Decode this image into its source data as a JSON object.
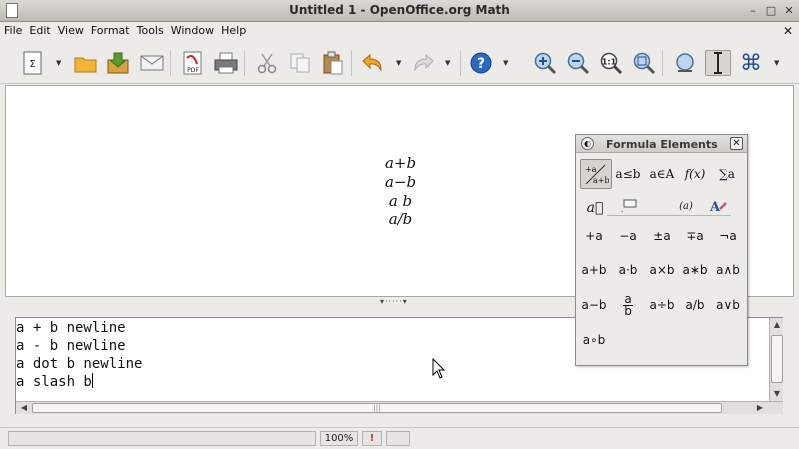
{
  "window": {
    "title": "Untitled 1 - OpenOffice.org Math",
    "buttons": {
      "minimize": "–",
      "maximize": "□",
      "close": "✕"
    }
  },
  "menubar": {
    "items": [
      "File",
      "Edit",
      "View",
      "Format",
      "Tools",
      "Window",
      "Help"
    ],
    "close_doc": "✕"
  },
  "toolbar": {
    "icons": [
      "new-formula-icon",
      "open-icon",
      "save-icon",
      "email-icon",
      "export-pdf-icon",
      "print-icon",
      "cut-icon",
      "copy-icon",
      "paste-icon",
      "undo-icon",
      "redo-icon",
      "help-icon",
      "zoom-in-icon",
      "zoom-out-icon",
      "zoom-100-icon",
      "show-all-icon",
      "update-icon",
      "formula-cursor-icon",
      "symbols-icon"
    ]
  },
  "preview": {
    "lines": [
      "a+b",
      "a−b",
      "a b",
      "a/b"
    ]
  },
  "editor": {
    "lines": [
      "a + b newline",
      "a - b newline",
      "a dot b newline",
      "a slash b"
    ]
  },
  "statusbar": {
    "zoom": "100%"
  },
  "panel": {
    "title": "Formula Elements",
    "categories_row1": [
      {
        "name": "unary-binary",
        "label": "+a a+b"
      },
      {
        "name": "relations",
        "label": "a≤b"
      },
      {
        "name": "set-operations",
        "label": "a∈A"
      },
      {
        "name": "functions",
        "label": "f(x)"
      },
      {
        "name": "operators",
        "label": "∑a"
      }
    ],
    "categories_row2": [
      {
        "name": "attributes",
        "label": "a⃗"
      },
      {
        "name": "others",
        "label": "…"
      },
      {
        "name": "brackets",
        "label": "(a)"
      },
      {
        "name": "formats",
        "label": "A"
      }
    ],
    "symbols": [
      [
        "+a",
        "−a",
        "±a",
        "∓a",
        "¬a"
      ],
      [
        "a+b",
        "a·b",
        "a×b",
        "a∗b",
        "a∧b"
      ],
      [
        "a−b",
        "a/b",
        "a÷b",
        "a/b",
        "a∨b"
      ],
      [
        "a∘b"
      ]
    ],
    "fraction": {
      "num": "a",
      "den": "b"
    }
  }
}
